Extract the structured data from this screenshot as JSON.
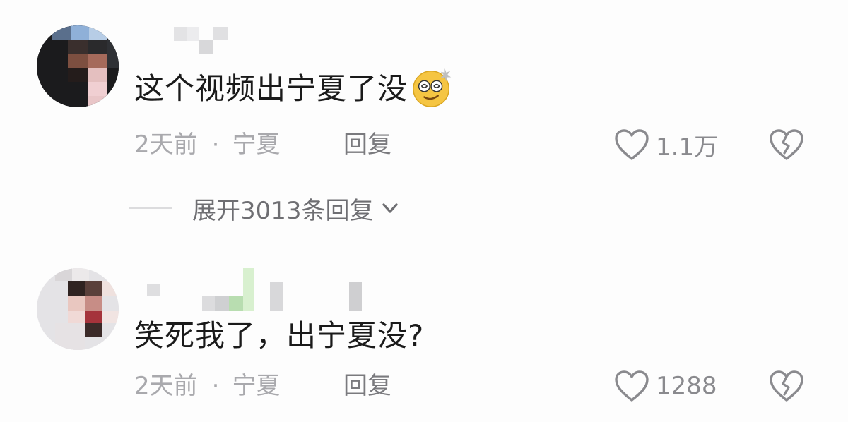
{
  "comments": [
    {
      "text": "这个视频出宁夏了没",
      "emoji": "dizzy-face-emoji",
      "time": "2天前",
      "separator": "·",
      "location": "宁夏",
      "reply_label": "回复",
      "likes": "1.1万"
    },
    {
      "text": "笑死我了，出宁夏没?",
      "time": "2天前",
      "separator": "·",
      "location": "宁夏",
      "reply_label": "回复",
      "likes": "1288"
    }
  ],
  "expand_replies": {
    "label": "展开3013条回复"
  },
  "icons": {
    "like": "heart-outline-icon",
    "dislike": "broken-heart-icon",
    "expand": "chevron-down-icon"
  },
  "colors": {
    "text": "#1a1a1a",
    "meta": "#a9a9ad",
    "icon": "#8a8a8e"
  }
}
